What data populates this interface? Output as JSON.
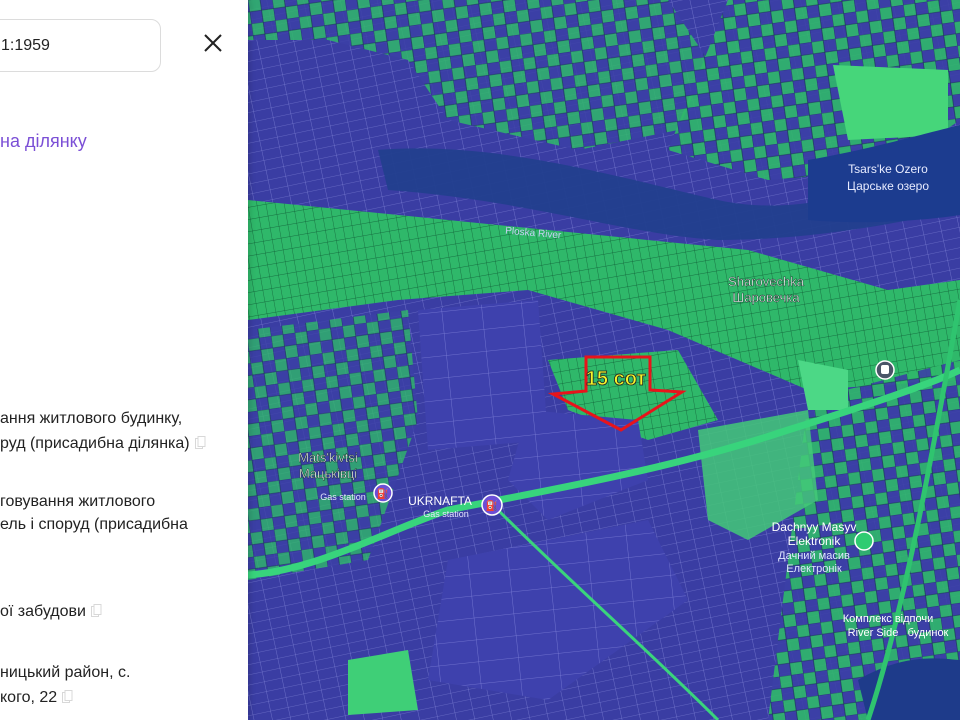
{
  "panel": {
    "search_value": "1:1959",
    "link_text": "на ділянку",
    "purpose_line1": "ання житлового будинку,",
    "purpose_line2": "руд (присадибна ділянка)",
    "purpose2_line1": "говування житлового",
    "purpose2_line2": "ель і споруд (присадибна",
    "category_text": "ої забудови",
    "address_line1": "ницький район, с.",
    "address_line2": "кого, 22"
  },
  "map": {
    "plot_label": "15 сот",
    "places": {
      "lake_en": "Tsars'ke Ozero",
      "lake_ua": "Царське озеро",
      "river": "Ploska River",
      "village1_en": "Sharovechka",
      "village1_ua": "Шаровечка",
      "village2_en": "Mats'kivtsi",
      "village2_ua": "Мацьківці",
      "gas1": "Gas station",
      "gas2_title": "UKRNAFTA",
      "gas2_sub": "Gas station",
      "dacha_en": "Dachnyy Masyv",
      "dacha_en2": "Elektronik",
      "dacha_ua": "Дачний масив",
      "dacha_ua2": "Електронік",
      "resort_ua": "Комплекс відпочи",
      "resort_en": "River Side",
      "resort_ua2": "будинок"
    },
    "colors": {
      "parcel_blue": "#3c3fa8",
      "parcel_green": "#2bbf6a",
      "water": "#1f3b8c",
      "road": "#33d17a",
      "arrow": "#e8141b",
      "label": "#f5f52a"
    }
  }
}
